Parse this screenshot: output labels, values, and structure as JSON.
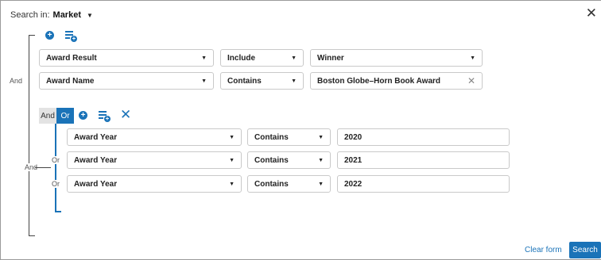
{
  "header": {
    "search_in_label": "Search in:",
    "search_in_value": "Market",
    "close_glyph": "✕"
  },
  "outer_group": {
    "joiner_left": "And",
    "joiner_mid": "And",
    "rows": [
      {
        "field": "Award Result",
        "operator": "Include",
        "value": "Winner",
        "value_type": "dropdown"
      },
      {
        "field": "Award Name",
        "operator": "Contains",
        "value": "Boston Globe–Horn Book Award",
        "value_type": "clearable",
        "joiner": "And"
      }
    ]
  },
  "inner_group": {
    "toggle_and": "And",
    "toggle_or": "Or",
    "selected": "Or",
    "rows": [
      {
        "field": "Award Year",
        "operator": "Contains",
        "value": "2020",
        "joiner": ""
      },
      {
        "field": "Award Year",
        "operator": "Contains",
        "value": "2021",
        "joiner": "Or"
      },
      {
        "field": "Award Year",
        "operator": "Contains",
        "value": "2022",
        "joiner": "Or"
      }
    ]
  },
  "footer": {
    "clear_label": "Clear form",
    "search_label": "Search"
  },
  "icons": {
    "add_condition": "plus-circle-icon",
    "add_group": "list-add-icon",
    "remove_group": "close-icon",
    "dropdown": "chevron-down-icon"
  },
  "colors": {
    "accent": "#1a73b8",
    "line": "#444444"
  }
}
